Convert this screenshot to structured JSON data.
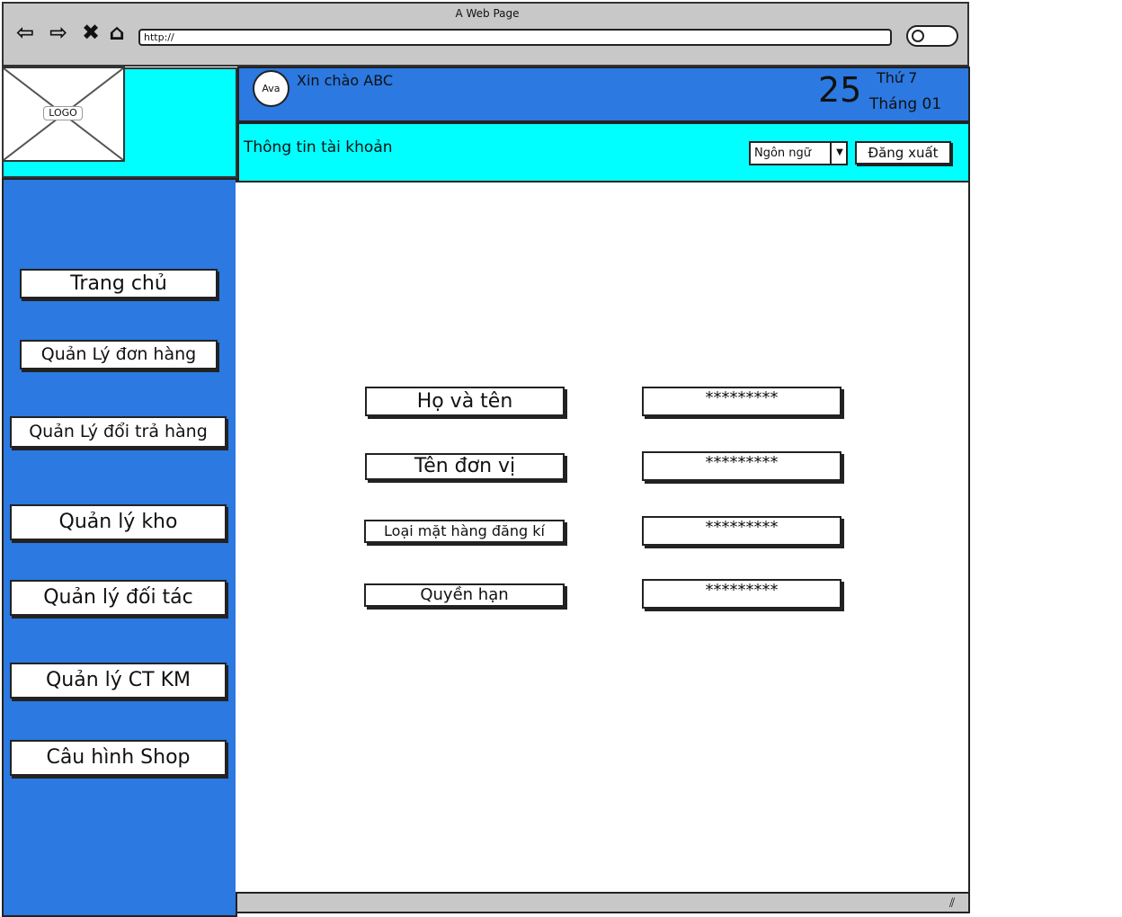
{
  "browser": {
    "window_title": "A Web Page",
    "url": "http://",
    "nav_icons": [
      "back-arrow-icon",
      "forward-arrow-icon",
      "close-icon",
      "home-icon"
    ],
    "search_icon": "magnifier-icon"
  },
  "logo": {
    "label": "LOGO"
  },
  "header": {
    "avatar_label": "Ava",
    "greeting": "Xin chào ABC",
    "day_number": "25",
    "weekday": "Thứ 7",
    "month": "Tháng 01"
  },
  "sub_header": {
    "title": "Thông tin tài khoản",
    "language_select": "Ngôn ngữ",
    "logout_label": "Đăng xuất"
  },
  "sidebar": {
    "items": [
      {
        "label": "Trang chủ"
      },
      {
        "label": "Quản Lý đơn hàng"
      },
      {
        "label": "Quản Lý đổi trả hàng"
      },
      {
        "label": "Quản lý kho"
      },
      {
        "label": "Quản lý đối tác"
      },
      {
        "label": "Quản lý CT KM"
      },
      {
        "label": "Câu hình Shop"
      }
    ]
  },
  "account_info": {
    "fields": [
      {
        "label": "Họ và tên",
        "value": "*********"
      },
      {
        "label": "Tên đơn vị",
        "value": "*********"
      },
      {
        "label": "Loại mặt hàng đăng kí",
        "value": "*********"
      },
      {
        "label": "Quyền hạn",
        "value": "*********"
      }
    ]
  },
  "colors": {
    "header_blue": "#2b79e1",
    "accent_cyan": "#00ffff",
    "chrome_gray": "#c8c8c8"
  }
}
